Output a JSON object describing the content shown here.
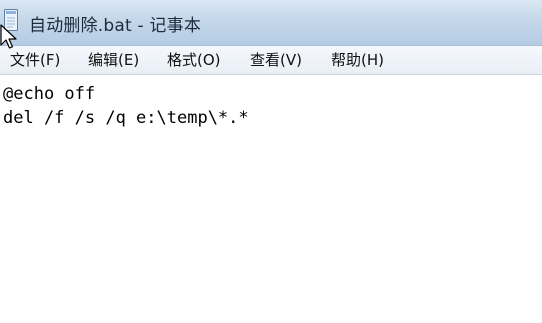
{
  "window": {
    "title": "自动删除.bat - 记事本"
  },
  "menubar": {
    "items": [
      {
        "label": "文件(F)"
      },
      {
        "label": "编辑(E)"
      },
      {
        "label": "格式(O)"
      },
      {
        "label": "查看(V)"
      },
      {
        "label": "帮助(H)"
      }
    ]
  },
  "editor": {
    "lines": [
      "@echo off",
      "del /f /s /q e:\\temp\\*.*"
    ]
  },
  "icons": {
    "app": "notepad-icon",
    "cursor": "mouse-pointer-icon"
  }
}
